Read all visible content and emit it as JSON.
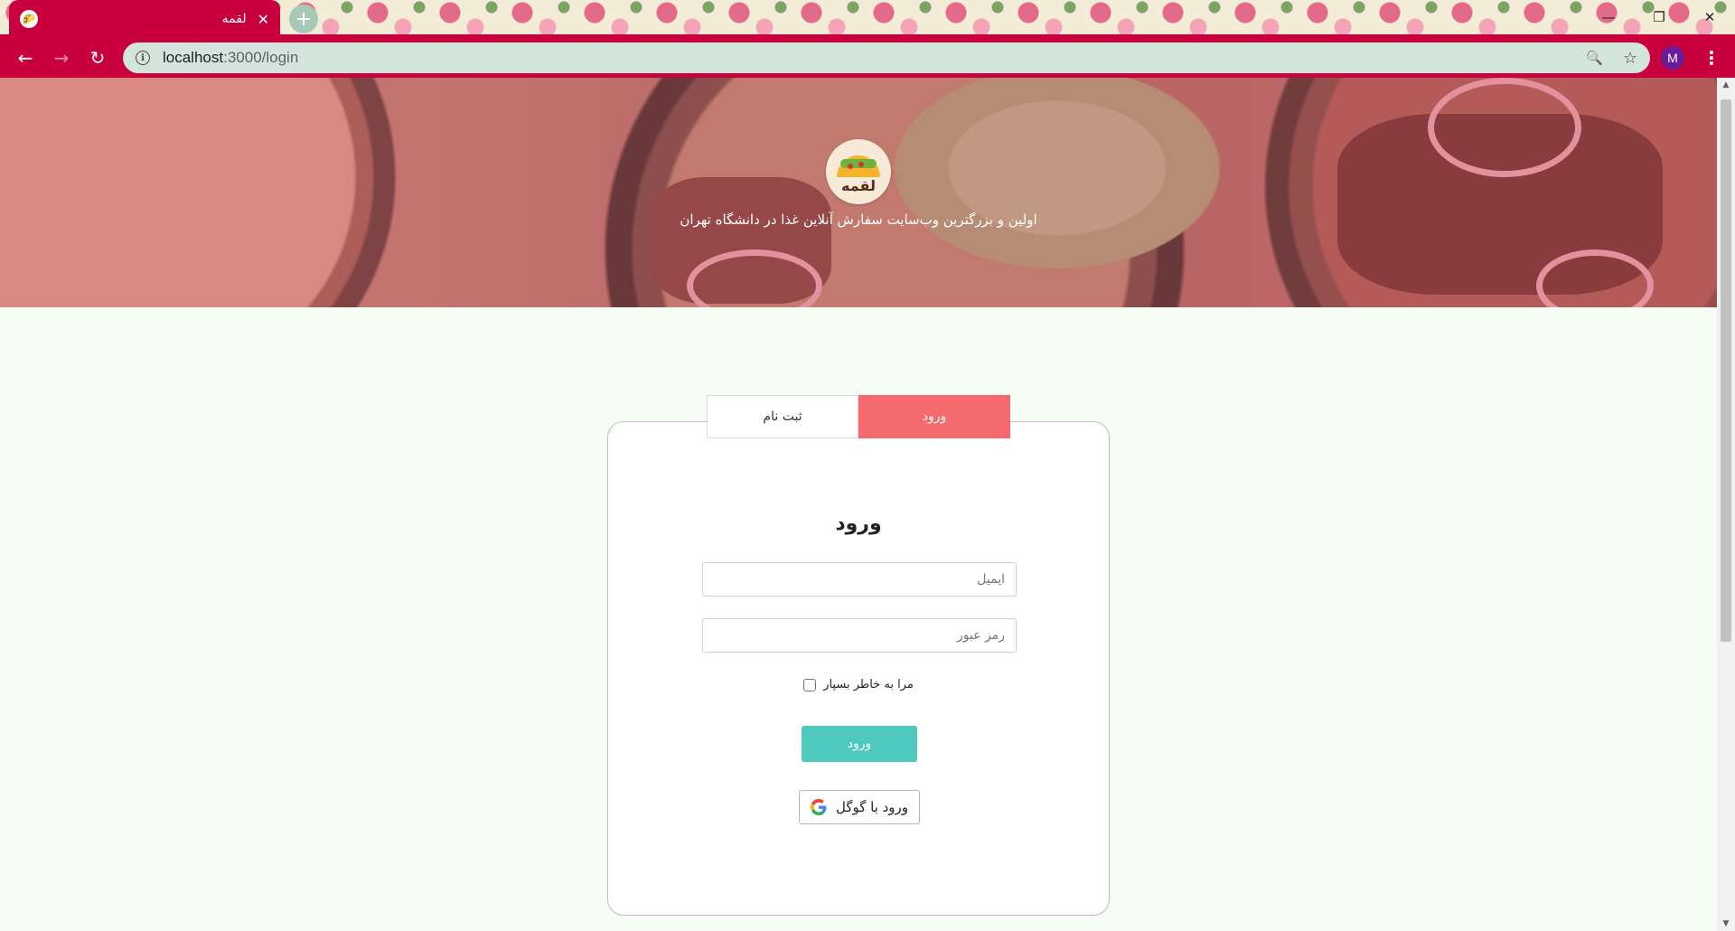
{
  "browser": {
    "tab_title": "لقمه",
    "tab_close": "✕",
    "new_tab": "+",
    "url_host": "localhost",
    "url_path": ":3000/login",
    "avatar_letter": "M",
    "window_minimize": "—",
    "window_restore": "❐",
    "window_close": "✕",
    "back_icon": "←",
    "forward_icon": "→",
    "reload_icon": "↻",
    "info_icon": "i",
    "zoom_icon": "🔍",
    "star_icon": "☆",
    "menu_icon": "⋮"
  },
  "hero": {
    "logo_text": "لقمه",
    "tagline": "اولین و بزرگترین وب‌سایت سفارش آنلاین غذا در دانشگاه تهران"
  },
  "auth": {
    "tab_register": "ثبت نام",
    "tab_login": "ورود",
    "title": "ورود",
    "email_placeholder": "ایمیل",
    "password_placeholder": "رمز عبور",
    "remember_me": "مرا به خاطر بسپار",
    "submit": "ورود",
    "google_login": "ورود با گوگل"
  },
  "colors": {
    "browser_accent": "#c8003e",
    "login_tab": "#f46a6f",
    "submit_button": "#4dc9bd",
    "page_background": "#f6fdf5"
  }
}
